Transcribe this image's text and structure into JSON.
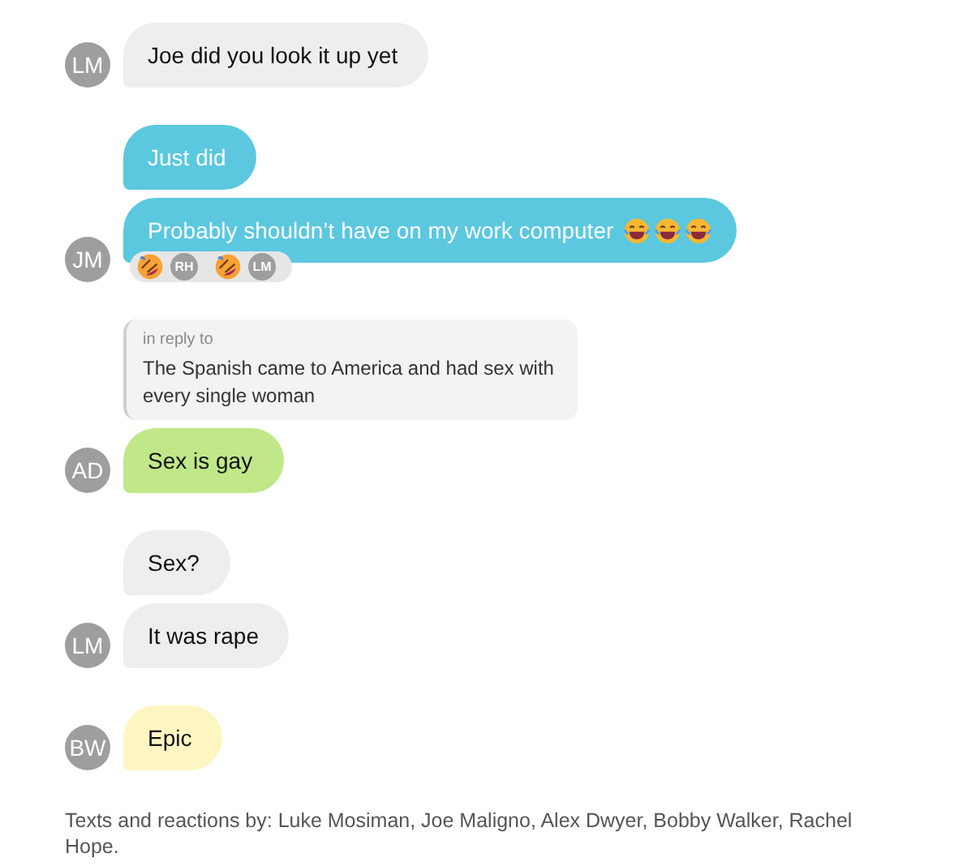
{
  "groups": [
    {
      "avatar": "LM",
      "color": "#eeeeee",
      "messages": [
        {
          "text": "Joe did you look it up yet"
        }
      ]
    },
    {
      "avatar": "JM",
      "color": "#5bc8e0",
      "messages": [
        {
          "text": "Just did"
        },
        {
          "text": "Probably shouldn’t have on my work computer",
          "emojis": [
            {
              "kind": "laughing"
            },
            {
              "kind": "laughing"
            },
            {
              "kind": "laughing"
            }
          ],
          "reactions": [
            {
              "by": "RH"
            },
            {
              "by": "LM"
            }
          ]
        }
      ]
    },
    {
      "avatar": "AD",
      "color": "#c0e888",
      "reply": {
        "label": "in reply to",
        "text": "The Spanish came to America and had sex with every single woman"
      },
      "messages": [
        {
          "text": "Sex is gay"
        }
      ]
    },
    {
      "avatar": "LM",
      "color": "#eeeeee",
      "messages": [
        {
          "text": "Sex?"
        },
        {
          "text": "It was rape"
        }
      ]
    },
    {
      "avatar": "BW",
      "color": "#fdf6c2",
      "messages": [
        {
          "text": "Epic"
        }
      ]
    }
  ],
  "footer": "Texts and reactions by: Luke Mosiman, Joe Maligno, Alex Dwyer, Bobby Walker, Rachel Hope."
}
